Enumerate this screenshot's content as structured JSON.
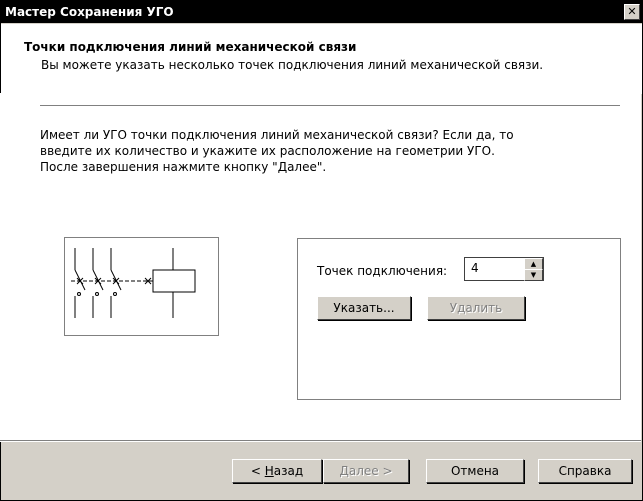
{
  "window": {
    "title": "Мастер Сохранения УГО",
    "close_glyph": "✕"
  },
  "header": {
    "title": "Точки подключения линий механической связи",
    "subtitle": "Вы можете указать несколько точек подключения линий механической связи."
  },
  "description": {
    "line1": "Имеет ли УГО точки подключения линий механической связи? Если да, то",
    "line2": "введите их количество и укажите их расположение на геометрии УГО.",
    "line3": "После завершения нажмите кнопку \"Далее\"."
  },
  "points": {
    "label": "Точек подключения:",
    "value": "4",
    "specify_button": "Указать...",
    "delete_button": "Удалить"
  },
  "footer": {
    "back_accel": "Н",
    "back_prefix": "< ",
    "back_rest": "азад",
    "next_button": "Далее >",
    "cancel_button": "Отмена",
    "help_button": "Справка"
  }
}
